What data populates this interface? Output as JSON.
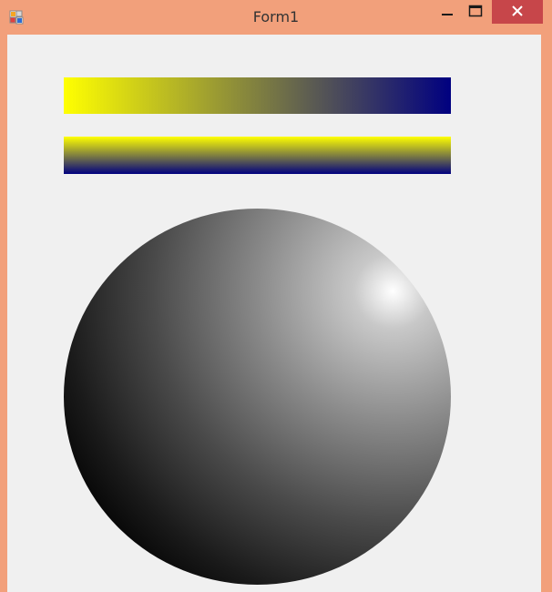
{
  "window": {
    "title": "Form1"
  },
  "icons": {
    "app": "app-icon",
    "minimize": "minimize-icon",
    "maximize": "maximize-icon",
    "close": "close-icon"
  },
  "gradients": {
    "horizontal_bar": {
      "start_color": "#FFFF00",
      "end_color": "#000080",
      "direction": "horizontal"
    },
    "vertical_bar": {
      "start_color": "#FFFF00",
      "end_color": "#000080",
      "direction": "vertical"
    },
    "sphere": {
      "highlight_color": "#FFFFFF",
      "shadow_color": "#000000",
      "type": "radial"
    }
  },
  "colors": {
    "titlebar": "#F2A07B",
    "close_button": "#C7464A",
    "client_background": "#F0F0F0"
  }
}
